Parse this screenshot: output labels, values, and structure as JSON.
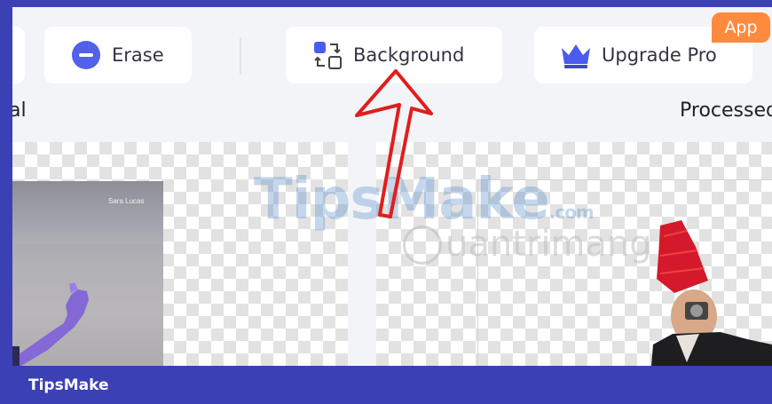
{
  "toolbar": {
    "erase_label": "Erase",
    "background_label": "Background",
    "upgrade_label": "Upgrade Pro",
    "app_badge": "App"
  },
  "labels": {
    "original": "al",
    "processed": "Processed"
  },
  "photo": {
    "caption": "Sara Lucas"
  },
  "watermarks": {
    "tipsmake": "TipsMake",
    "tipsmake_suffix": ".com",
    "quantrimang": "uantrimang"
  },
  "footer": {
    "brand": "TipsMake"
  },
  "colors": {
    "frame": "#3c40b5",
    "erase_icon": "#5260ea",
    "background_icon": "#4b5bf0",
    "crown": "#4b5bf0",
    "app_badge": "#ff8a3d",
    "arrow": "#e01e1e"
  },
  "icons": {
    "erase": "minus-circle-icon",
    "background": "swap-shapes-icon",
    "upgrade": "crown-icon"
  }
}
